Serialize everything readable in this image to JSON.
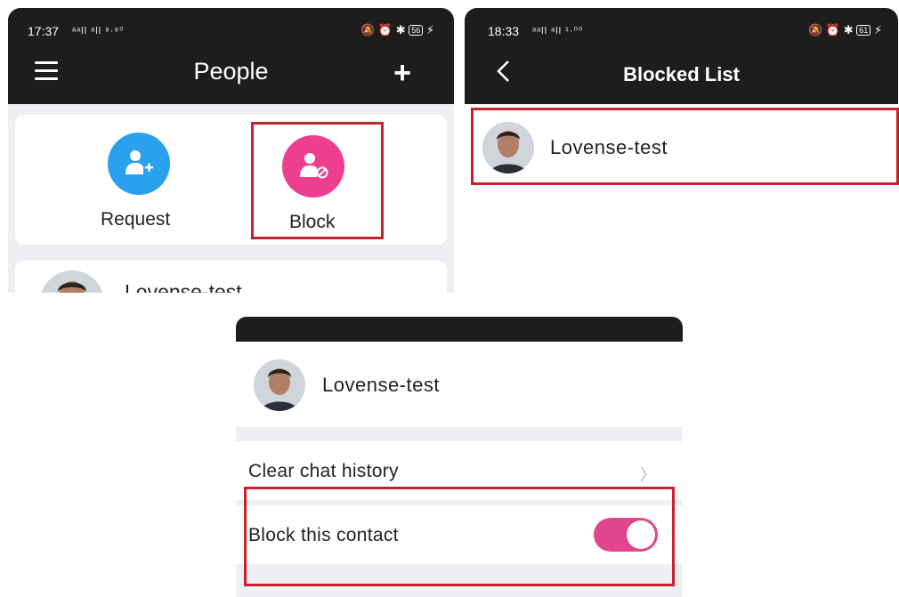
{
  "people_screen": {
    "status": {
      "time": "17:37",
      "signal": "ᵃᵃll ᵃll ⁸·⁸⁰",
      "icons": "🔕 ⏰ ✱",
      "battery": "56"
    },
    "title": "People",
    "actions": [
      {
        "label": "Request",
        "icon": "add-person-icon",
        "color": "#2aa1ef"
      },
      {
        "label": "Block",
        "icon": "block-person-icon",
        "color": "#ef3e8f"
      }
    ],
    "contact": {
      "name": "Lovense-test"
    }
  },
  "blocked_screen": {
    "status": {
      "time": "18:33",
      "signal": "ᵃᵃll ᵃll ¹·⁰⁰",
      "icons": "🔕 ⏰ ✱",
      "battery": "61"
    },
    "title": "Blocked List",
    "contacts": [
      {
        "name": "Lovense-test"
      }
    ]
  },
  "contact_screen": {
    "contact": {
      "name": "Lovense-test"
    },
    "items": [
      {
        "label": "Clear chat history"
      },
      {
        "label": "Block this contact",
        "toggle_on": true
      }
    ]
  },
  "colors": {
    "highlight": "#c8212e",
    "topbar": "#1d1d1d",
    "accent_pink": "#e0468d"
  }
}
